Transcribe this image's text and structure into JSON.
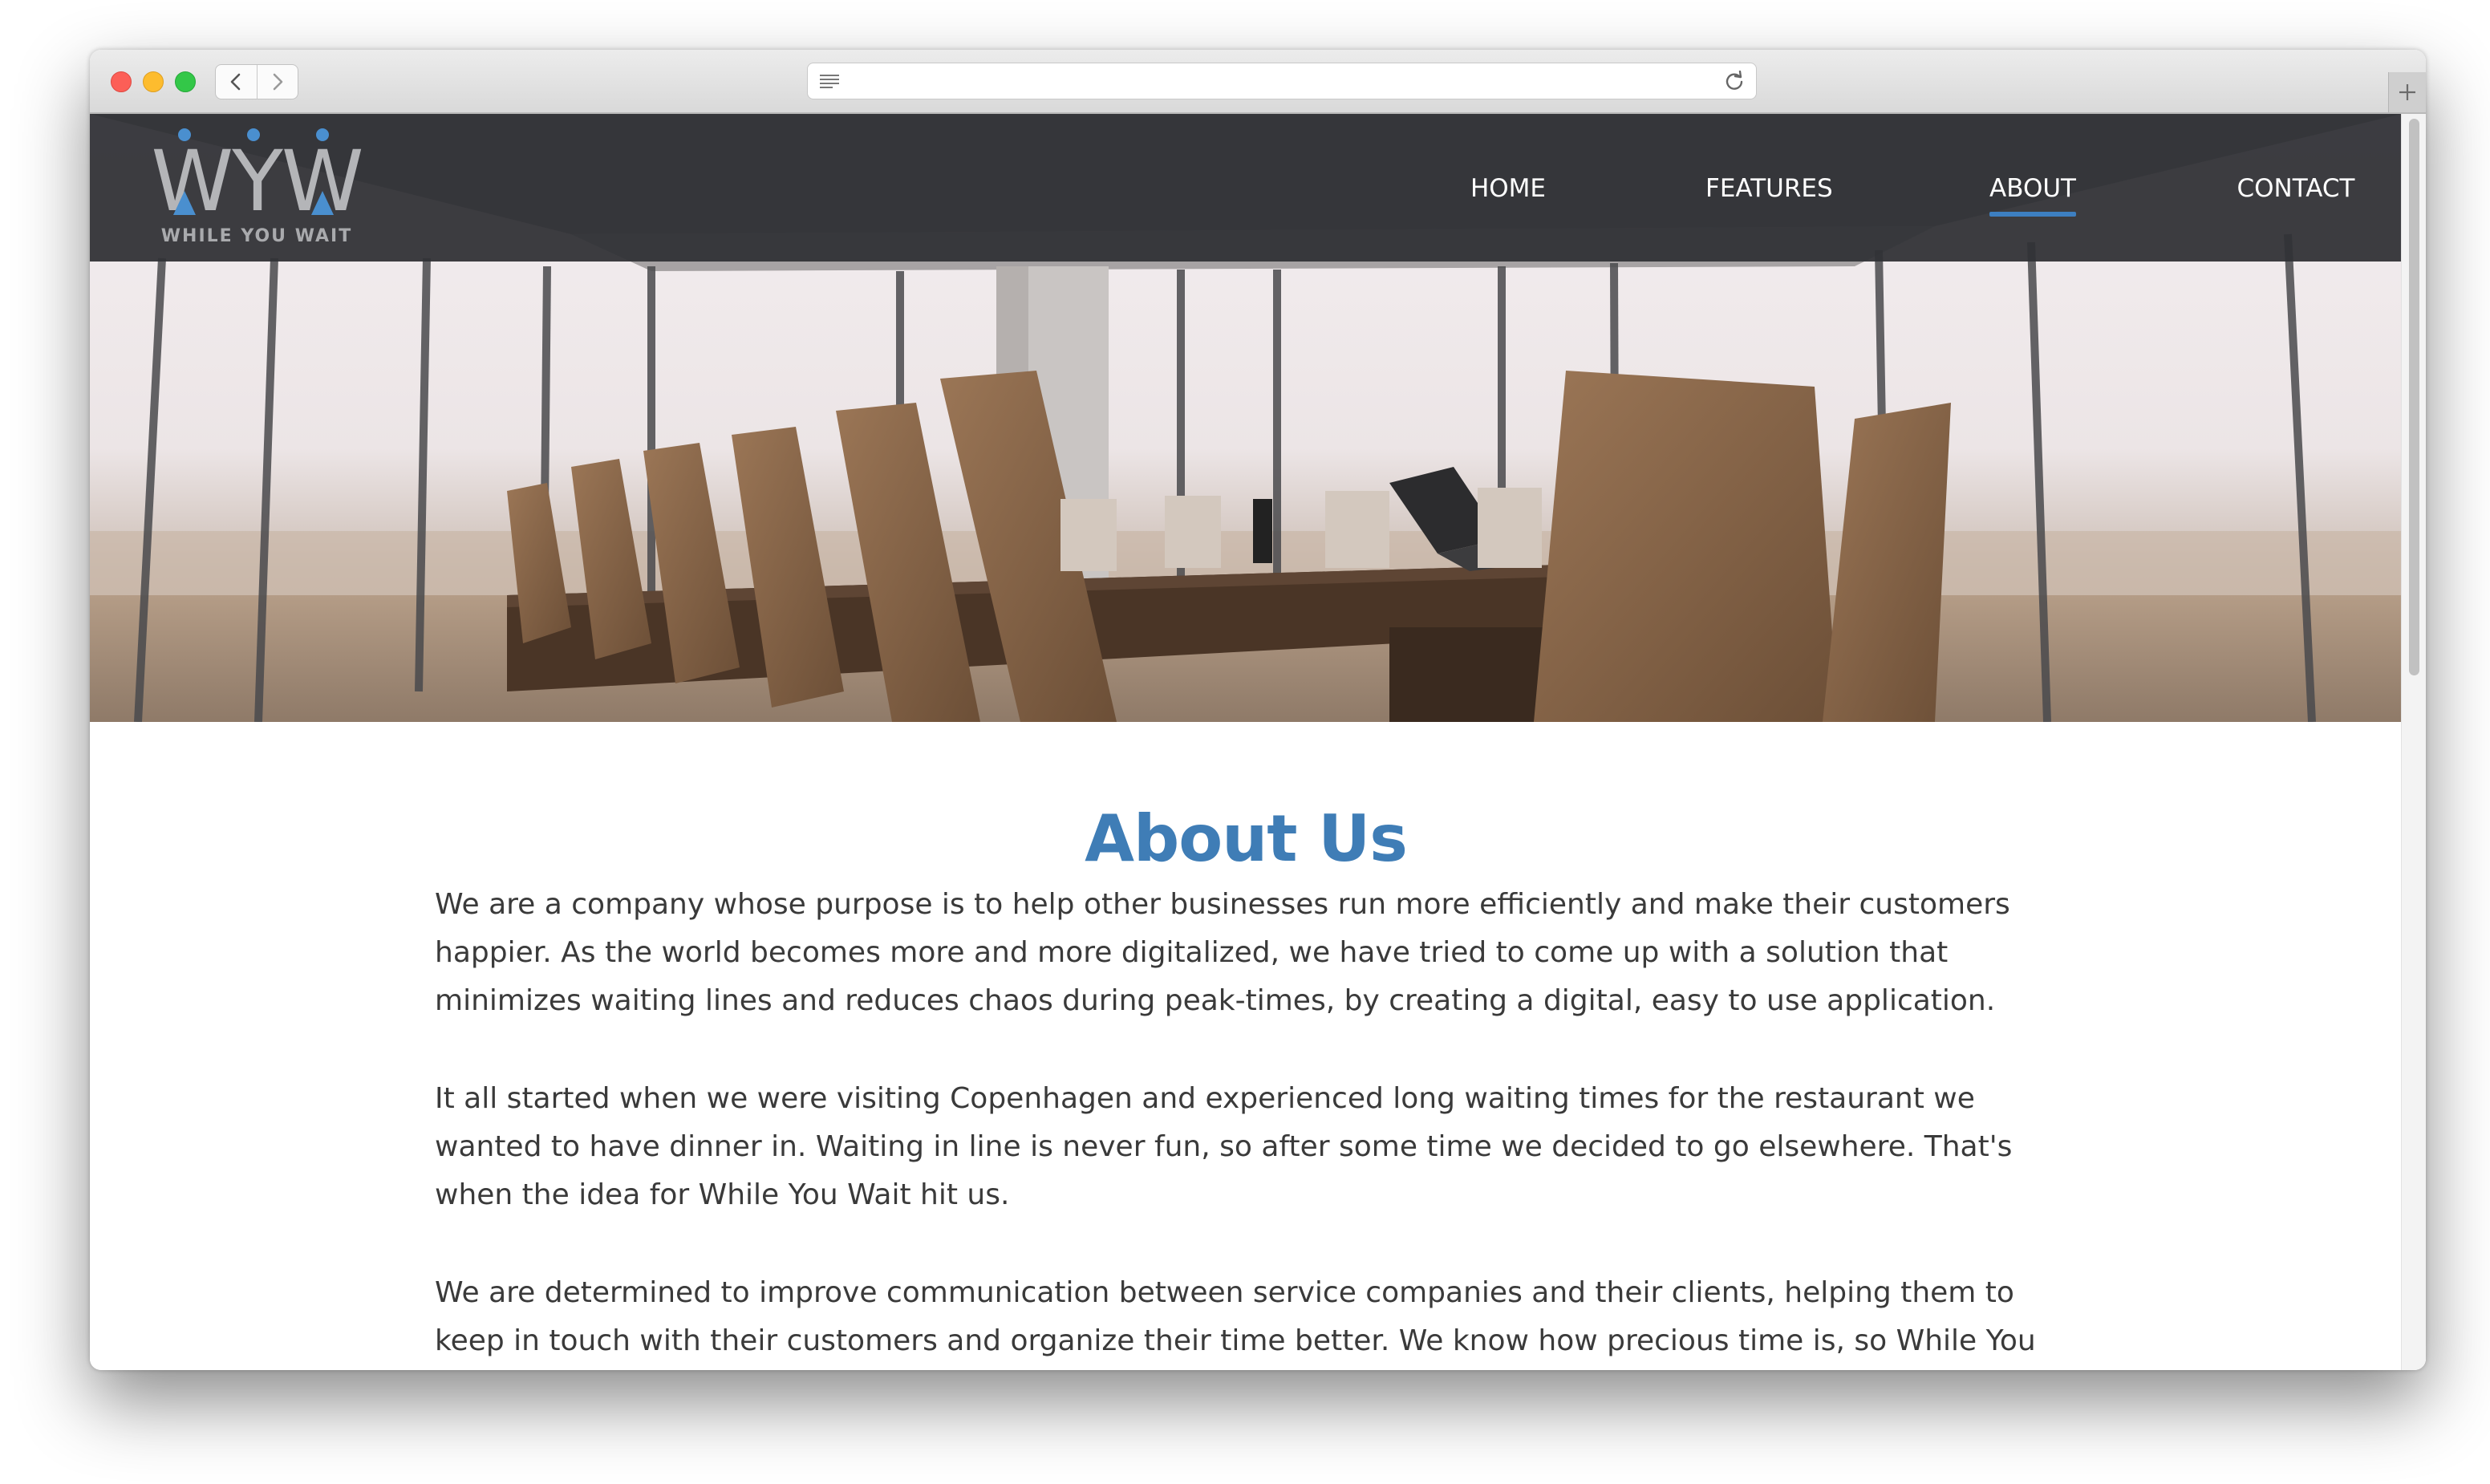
{
  "brand": {
    "logo_letters": "WYW",
    "tagline": "WHILE YOU WAIT",
    "accent_color": "#3f7db6"
  },
  "browser": {
    "icons": [
      "back-arrow-icon",
      "forward-arrow-icon",
      "reader-icon",
      "reload-icon",
      "plus-icon"
    ]
  },
  "nav": {
    "items": [
      {
        "label": "HOME",
        "active": false
      },
      {
        "label": "FEATURES",
        "active": false
      },
      {
        "label": "ABOUT",
        "active": true
      },
      {
        "label": "CONTACT",
        "active": false
      }
    ]
  },
  "hero": {
    "image": "conference-room-photo"
  },
  "about": {
    "title": "About Us",
    "paragraphs": [
      "We are a company whose purpose is to help other businesses run more efficiently and make their customers happier. As the world becomes more and more digitalized, we have tried to come up with a solution that minimizes waiting lines and reduces chaos during peak-times, by creating a digital, easy to use application.",
      "It all started when we were visiting Copenhagen and experienced long waiting times for the restaurant we wanted to have dinner in. Waiting in line is never fun, so after some time we decided to go elsewhere. That's when the idea for While You Wait hit us.",
      "We are determined to improve communication between service companies and their clients, helping them to keep in touch with their customers and organize their time better. We know how precious time is, so While You"
    ]
  }
}
